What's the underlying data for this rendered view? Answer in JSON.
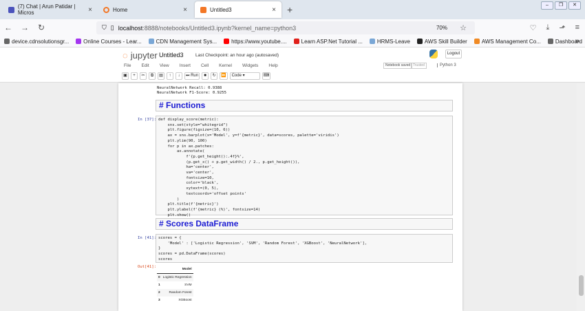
{
  "browser": {
    "tabs": [
      {
        "label": "(7) Chat | Arun Patidar | Micros",
        "color": "#4b53bc"
      },
      {
        "label": "Home",
        "color": "#f37726"
      },
      {
        "label": "Untitled3",
        "color": "#f37726",
        "active": true
      }
    ],
    "url_host": "localhost",
    "url_rest": ":8888/notebooks/Untitled3.ipynb?kernel_name=python3",
    "zoom": "70%",
    "bookmarks": [
      {
        "label": "device.cdnsolutionsgr...",
        "color": "#666"
      },
      {
        "label": "Online Courses - Lear...",
        "color": "#a435f0"
      },
      {
        "label": "CDN Management Sys...",
        "color": "#7aa7d6"
      },
      {
        "label": "https://www.youtube....",
        "color": "#ff0000"
      },
      {
        "label": "Learn ASP.Net Tutorial ...",
        "color": "#e0201b"
      },
      {
        "label": "HRMS-Leave",
        "color": "#7aa7d6"
      },
      {
        "label": "AWS Skill Builder",
        "color": "#222"
      },
      {
        "label": "AWS Management Co...",
        "color": "#f08a24"
      },
      {
        "label": "Dashboard",
        "color": "#666"
      }
    ]
  },
  "jupyter": {
    "logo": "jupyter",
    "notebook_name": "Untitled3",
    "checkpoint": "Last Checkpoint: an hour ago  (autosaved)",
    "logout": "Logout",
    "menu": [
      "File",
      "Edit",
      "View",
      "Insert",
      "Cell",
      "Kernel",
      "Widgets",
      "Help"
    ],
    "status": "Notebook saved",
    "trusted": "Trusted",
    "kernel": "Python 3",
    "toolbar": {
      "run": "Run",
      "cell_type": "Code"
    }
  },
  "cells": {
    "prev_output": [
      "NeuralNetwork Recall: 0.9388",
      "NeuralNetwork F1-Score: 0.9255"
    ],
    "md1": "# Functions",
    "c1_prompt": "In [37]:",
    "c1_lines": [
      "def display_score(metric):",
      "    sns.set(style=\"whitegrid\")",
      "    plt.figure(figsize=(10, 6))",
      "    ax = sns.barplot(x='Model', y=f'{metric}', data=scores, palette='viridis')",
      "    plt.ylim(90, 100)",
      "    for p in ax.patches:",
      "        ax.annotate(",
      "            f'{p.get_height():.4f}%',",
      "            (p.get_x() + p.get_width() / 2., p.get_height()),",
      "            ha='center',",
      "            va='center',",
      "            fontsize=10,",
      "            color='black',",
      "            xytext=(0, 5),",
      "            textcoords='offset points'",
      "        )",
      "    plt.title(f'{metric}')",
      "    plt.ylabel(f'{metric} (%)', fontsize=14)",
      "    plt.show()"
    ],
    "md2": "# Scores DataFrame",
    "c2_prompt": "In [41]:",
    "c2_lines": [
      "scores = {",
      "    'Model' : ['Logistic Regression', 'SVM', 'Random Forest', 'XGBoost', 'NeuralNetwork'],",
      "}",
      "scores = pd.DataFrame(scores)",
      "scores"
    ],
    "out_prompt": "Out[41]:",
    "table": {
      "header": "Model",
      "rows": [
        [
          "0",
          "Logistic Regression"
        ],
        [
          "1",
          "SVM"
        ],
        [
          "2",
          "Random Forest"
        ],
        [
          "3",
          "XGBoost"
        ]
      ]
    }
  }
}
